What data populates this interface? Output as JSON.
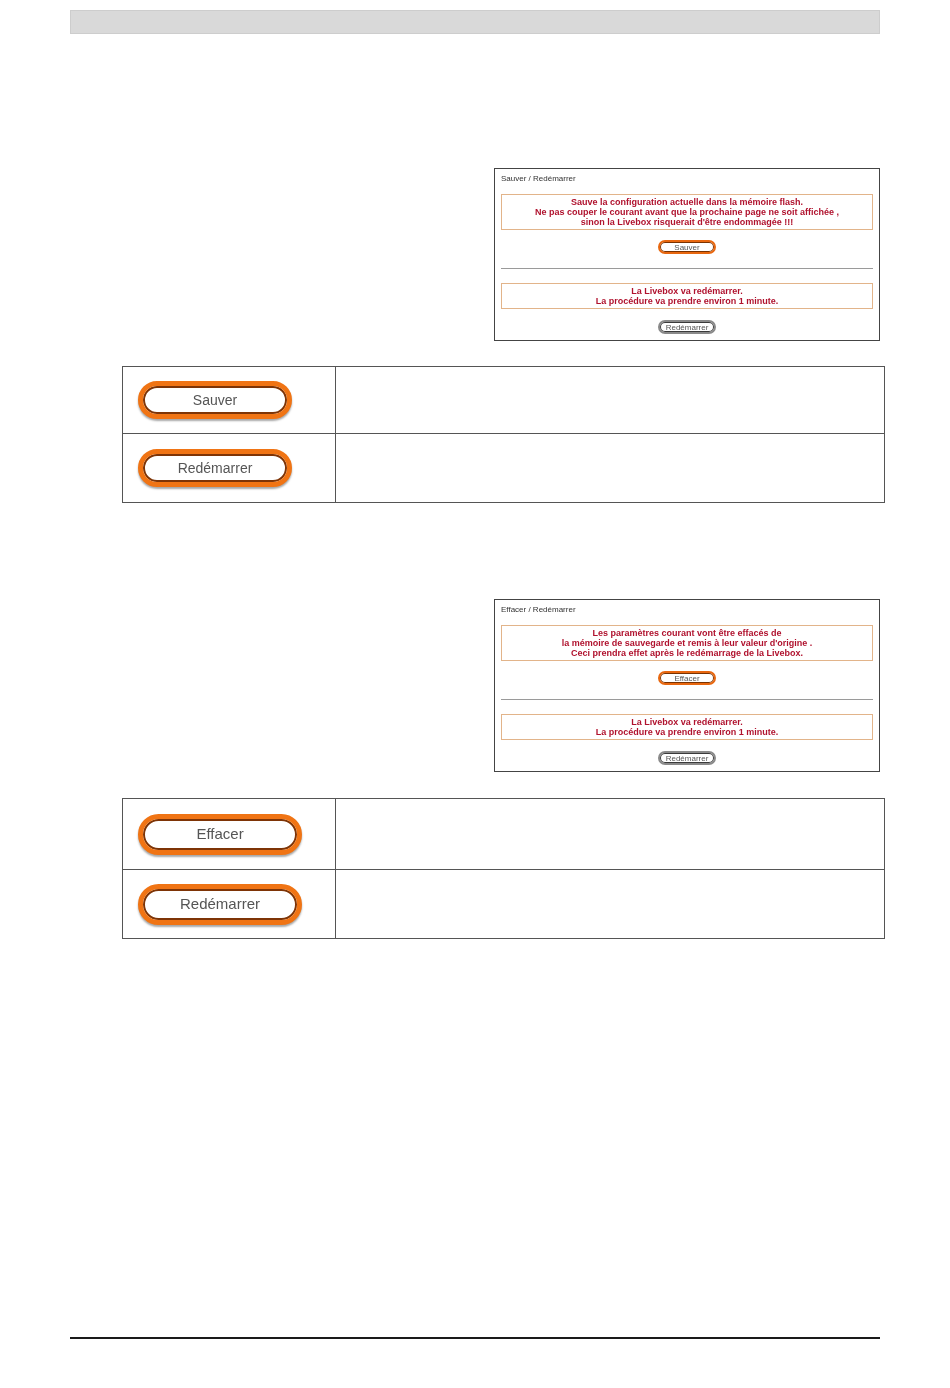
{
  "sections": [
    {
      "screenshot": {
        "title": "Sauver / Redémarrer",
        "blocks": [
          {
            "message": [
              "Sauve la configuration actuelle dans la mémoire flash.",
              "Ne pas couper le courant avant que la prochaine page ne soit affichée ,",
              "sinon la Livebox risquerait d'être endommagée !!!"
            ],
            "button": {
              "label": "Sauver",
              "highlighted": true
            }
          },
          {
            "message": [
              "La Livebox va redémarrer.",
              "La procédure va prendre environ 1 minute."
            ],
            "button": {
              "label": "Redémarrer",
              "highlighted": false
            }
          }
        ]
      },
      "button_table": {
        "rows": [
          {
            "button": "Sauver"
          },
          {
            "button": "Redémarrer"
          }
        ]
      }
    },
    {
      "screenshot": {
        "title": "Effacer / Redémarrer",
        "blocks": [
          {
            "message": [
              "Les paramètres courant vont être effacés de",
              "la mémoire de sauvegarde et remis à leur valeur d'origine .",
              "Ceci prendra effet après le redémarrage de la Livebox."
            ],
            "button": {
              "label": "Effacer",
              "highlighted": true
            }
          },
          {
            "message": [
              "La Livebox va redémarrer.",
              "La procédure va prendre environ 1 minute."
            ],
            "button": {
              "label": "Redémarrer",
              "highlighted": false
            }
          }
        ]
      },
      "button_table": {
        "rows": [
          {
            "button": "Effacer"
          },
          {
            "button": "Redémarrer"
          }
        ]
      }
    }
  ]
}
